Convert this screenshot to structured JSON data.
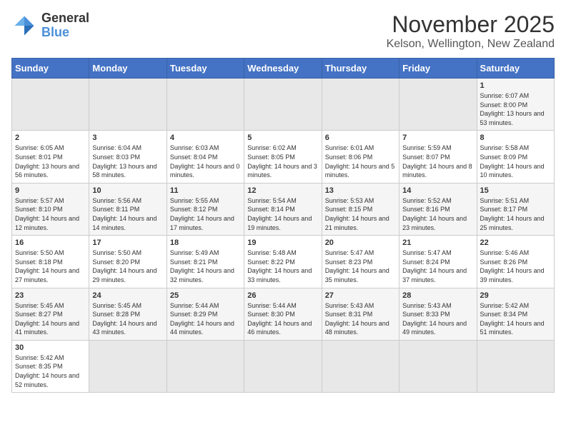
{
  "logo": {
    "text_general": "General",
    "text_blue": "Blue"
  },
  "calendar": {
    "title": "November 2025",
    "subtitle": "Kelson, Wellington, New Zealand"
  },
  "days_of_week": [
    "Sunday",
    "Monday",
    "Tuesday",
    "Wednesday",
    "Thursday",
    "Friday",
    "Saturday"
  ],
  "weeks": [
    [
      {
        "day": "",
        "info": ""
      },
      {
        "day": "",
        "info": ""
      },
      {
        "day": "",
        "info": ""
      },
      {
        "day": "",
        "info": ""
      },
      {
        "day": "",
        "info": ""
      },
      {
        "day": "",
        "info": ""
      },
      {
        "day": "1",
        "info": "Sunrise: 6:07 AM\nSunset: 8:00 PM\nDaylight: 13 hours and 53 minutes."
      }
    ],
    [
      {
        "day": "2",
        "info": "Sunrise: 6:05 AM\nSunset: 8:01 PM\nDaylight: 13 hours and 56 minutes."
      },
      {
        "day": "3",
        "info": "Sunrise: 6:04 AM\nSunset: 8:03 PM\nDaylight: 13 hours and 58 minutes."
      },
      {
        "day": "4",
        "info": "Sunrise: 6:03 AM\nSunset: 8:04 PM\nDaylight: 14 hours and 0 minutes."
      },
      {
        "day": "5",
        "info": "Sunrise: 6:02 AM\nSunset: 8:05 PM\nDaylight: 14 hours and 3 minutes."
      },
      {
        "day": "6",
        "info": "Sunrise: 6:01 AM\nSunset: 8:06 PM\nDaylight: 14 hours and 5 minutes."
      },
      {
        "day": "7",
        "info": "Sunrise: 5:59 AM\nSunset: 8:07 PM\nDaylight: 14 hours and 8 minutes."
      },
      {
        "day": "8",
        "info": "Sunrise: 5:58 AM\nSunset: 8:09 PM\nDaylight: 14 hours and 10 minutes."
      }
    ],
    [
      {
        "day": "9",
        "info": "Sunrise: 5:57 AM\nSunset: 8:10 PM\nDaylight: 14 hours and 12 minutes."
      },
      {
        "day": "10",
        "info": "Sunrise: 5:56 AM\nSunset: 8:11 PM\nDaylight: 14 hours and 14 minutes."
      },
      {
        "day": "11",
        "info": "Sunrise: 5:55 AM\nSunset: 8:12 PM\nDaylight: 14 hours and 17 minutes."
      },
      {
        "day": "12",
        "info": "Sunrise: 5:54 AM\nSunset: 8:14 PM\nDaylight: 14 hours and 19 minutes."
      },
      {
        "day": "13",
        "info": "Sunrise: 5:53 AM\nSunset: 8:15 PM\nDaylight: 14 hours and 21 minutes."
      },
      {
        "day": "14",
        "info": "Sunrise: 5:52 AM\nSunset: 8:16 PM\nDaylight: 14 hours and 23 minutes."
      },
      {
        "day": "15",
        "info": "Sunrise: 5:51 AM\nSunset: 8:17 PM\nDaylight: 14 hours and 25 minutes."
      }
    ],
    [
      {
        "day": "16",
        "info": "Sunrise: 5:50 AM\nSunset: 8:18 PM\nDaylight: 14 hours and 27 minutes."
      },
      {
        "day": "17",
        "info": "Sunrise: 5:50 AM\nSunset: 8:20 PM\nDaylight: 14 hours and 29 minutes."
      },
      {
        "day": "18",
        "info": "Sunrise: 5:49 AM\nSunset: 8:21 PM\nDaylight: 14 hours and 32 minutes."
      },
      {
        "day": "19",
        "info": "Sunrise: 5:48 AM\nSunset: 8:22 PM\nDaylight: 14 hours and 33 minutes."
      },
      {
        "day": "20",
        "info": "Sunrise: 5:47 AM\nSunset: 8:23 PM\nDaylight: 14 hours and 35 minutes."
      },
      {
        "day": "21",
        "info": "Sunrise: 5:47 AM\nSunset: 8:24 PM\nDaylight: 14 hours and 37 minutes."
      },
      {
        "day": "22",
        "info": "Sunrise: 5:46 AM\nSunset: 8:26 PM\nDaylight: 14 hours and 39 minutes."
      }
    ],
    [
      {
        "day": "23",
        "info": "Sunrise: 5:45 AM\nSunset: 8:27 PM\nDaylight: 14 hours and 41 minutes."
      },
      {
        "day": "24",
        "info": "Sunrise: 5:45 AM\nSunset: 8:28 PM\nDaylight: 14 hours and 43 minutes."
      },
      {
        "day": "25",
        "info": "Sunrise: 5:44 AM\nSunset: 8:29 PM\nDaylight: 14 hours and 44 minutes."
      },
      {
        "day": "26",
        "info": "Sunrise: 5:44 AM\nSunset: 8:30 PM\nDaylight: 14 hours and 46 minutes."
      },
      {
        "day": "27",
        "info": "Sunrise: 5:43 AM\nSunset: 8:31 PM\nDaylight: 14 hours and 48 minutes."
      },
      {
        "day": "28",
        "info": "Sunrise: 5:43 AM\nSunset: 8:33 PM\nDaylight: 14 hours and 49 minutes."
      },
      {
        "day": "29",
        "info": "Sunrise: 5:42 AM\nSunset: 8:34 PM\nDaylight: 14 hours and 51 minutes."
      }
    ],
    [
      {
        "day": "30",
        "info": "Sunrise: 5:42 AM\nSunset: 8:35 PM\nDaylight: 14 hours and 52 minutes."
      },
      {
        "day": "",
        "info": ""
      },
      {
        "day": "",
        "info": ""
      },
      {
        "day": "",
        "info": ""
      },
      {
        "day": "",
        "info": ""
      },
      {
        "day": "",
        "info": ""
      },
      {
        "day": "",
        "info": ""
      }
    ]
  ]
}
